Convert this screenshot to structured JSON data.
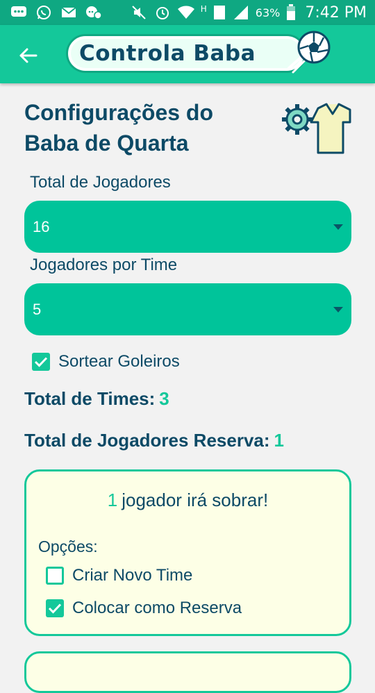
{
  "status_bar": {
    "battery_percent": "63%",
    "network_label": "H",
    "sim_label": "1",
    "time": "7:42 PM"
  },
  "app_bar": {
    "logo_text": "Controla Baba",
    "colors": {
      "primary": "#14c89a",
      "dark": "#0d4a66",
      "status": "#0fa882"
    }
  },
  "page": {
    "title_line1": "Configurações do",
    "title_line2": "Baba de Quarta"
  },
  "fields": {
    "total_players_label": "Total de Jogadores",
    "total_players_value": "16",
    "players_per_team_label": "Jogadores por Time",
    "players_per_team_value": "5"
  },
  "options": {
    "draw_goalkeepers_label": "Sortear Goleiros",
    "draw_goalkeepers_checked": true
  },
  "stats": {
    "total_teams_label": "Total de Times:",
    "total_teams_value": "3",
    "total_reserve_label": "Total de Jogadores Reserva:",
    "total_reserve_value": "1"
  },
  "notice": {
    "count": "1",
    "message": "jogador irá sobrar!",
    "options_label": "Opções:",
    "create_new_team_label": "Criar Novo Time",
    "create_new_team_checked": false,
    "set_as_reserve_label": "Colocar como Reserva",
    "set_as_reserve_checked": true
  },
  "icons": [
    "back-arrow-icon",
    "soccer-ball-icon",
    "gear-icon",
    "shirt-icon",
    "dropdown-caret-icon",
    "checkmark-icon"
  ]
}
